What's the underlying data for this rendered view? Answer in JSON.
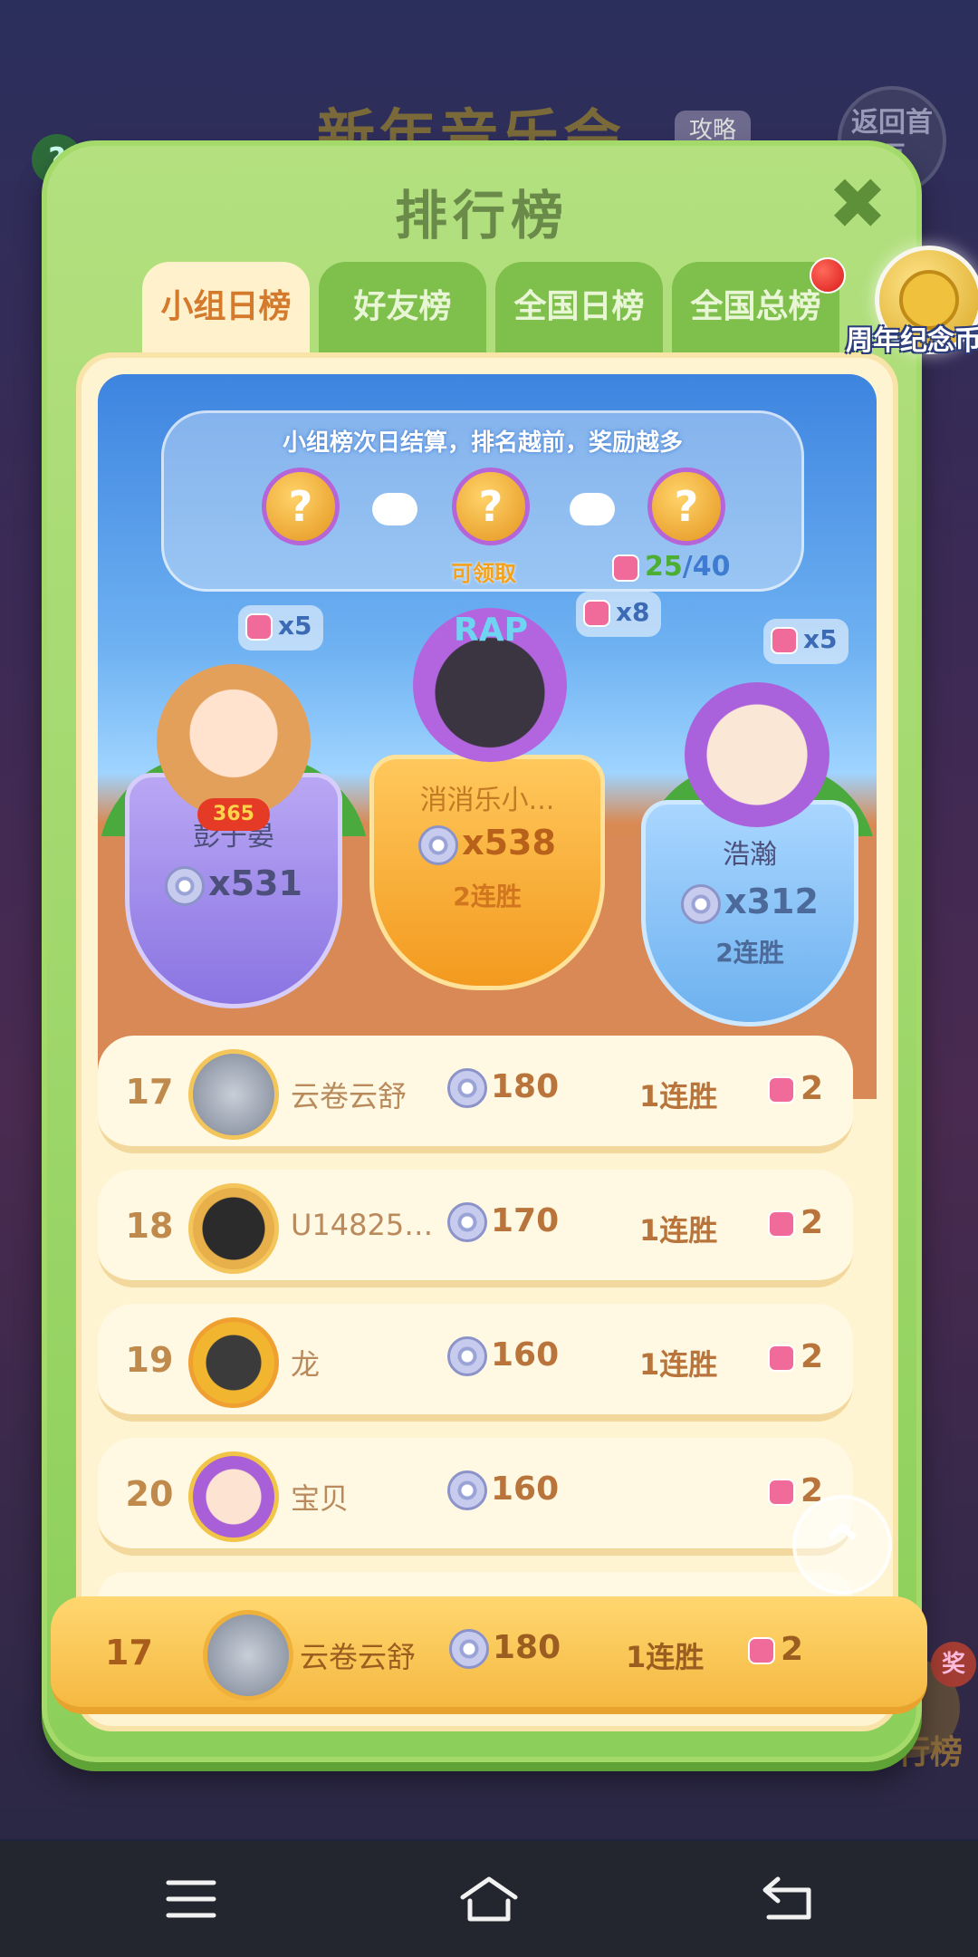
{
  "background": {
    "title": "新年音乐会",
    "guide_label": "攻略",
    "back_label": "返回首页",
    "help_label": "?",
    "bottom_label": "排行榜",
    "bottom_tag": "奖"
  },
  "panel": {
    "title": "排行榜",
    "close_icon": "close-icon",
    "tabs": [
      {
        "label": "小组日榜",
        "active": true
      },
      {
        "label": "好友榜",
        "active": false
      },
      {
        "label": "全国日榜",
        "active": false
      },
      {
        "label": "全国总榜",
        "active": false
      }
    ],
    "anniversary_coin_label": "周年纪念币"
  },
  "rewards": {
    "title": "小组榜次日结算，排名越前，奖励越多",
    "claimable_label": "可领取",
    "progress_current": "25",
    "progress_total": "/40"
  },
  "podium": [
    {
      "place": 2,
      "name": "彭于晏",
      "score": "x531",
      "streak": "",
      "reward": "x5",
      "avatar_badge": "365"
    },
    {
      "place": 1,
      "name": "消消乐小...",
      "score": "x538",
      "streak": "2连胜",
      "reward": "x8",
      "hat_text": "RAP"
    },
    {
      "place": 3,
      "name": "浩瀚",
      "score": "x312",
      "streak": "2连胜",
      "reward": "x5"
    }
  ],
  "list": [
    {
      "rank": "17",
      "name": "云卷云舒",
      "score": "180",
      "streak": "1连胜",
      "pieces": "2"
    },
    {
      "rank": "18",
      "name": "U148255...",
      "score": "170",
      "streak": "1连胜",
      "pieces": "2"
    },
    {
      "rank": "19",
      "name": "龙",
      "score": "160",
      "streak": "1连胜",
      "pieces": "2"
    },
    {
      "rank": "20",
      "name": "宝贝",
      "score": "160",
      "streak": "",
      "pieces": "2"
    }
  ],
  "self": {
    "rank": "17",
    "name": "云卷云舒",
    "score": "180",
    "streak": "1连胜",
    "pieces": "2"
  },
  "colors": {
    "panel_green": "#8ccf5a",
    "active_tab": "#fff1cc",
    "gold": "#f5b942",
    "sky_blue": "#6fb2f2"
  },
  "navbar": {
    "icons": [
      "menu-icon",
      "home-icon",
      "back-icon"
    ]
  }
}
